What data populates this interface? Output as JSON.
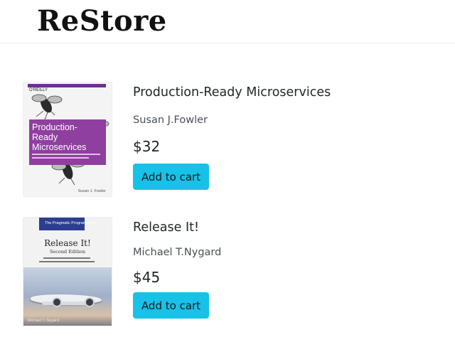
{
  "brand": "ReStore",
  "books": [
    {
      "title": "Production-Ready Microservices",
      "author": "Susan J.Fowler",
      "price": "$32",
      "button_label": "Add to cart",
      "cover": {
        "publisher": "O'REILLY",
        "title": "Production-Ready Microservices",
        "author": "Susan J. Fowler",
        "accent": "#8f3f9f"
      }
    },
    {
      "title": "Release It!",
      "author": "Michael T.Nygard",
      "price": "$45",
      "button_label": "Add to cart",
      "cover": {
        "publisher": "The Pragmatic Programmers",
        "title": "Release It!",
        "edition": "Second Edition",
        "author": "Michael T. Nygard",
        "accent": "#2c3e8f"
      }
    }
  ],
  "colors": {
    "button": "#17c1e8",
    "header_border": "#e9ecef"
  }
}
